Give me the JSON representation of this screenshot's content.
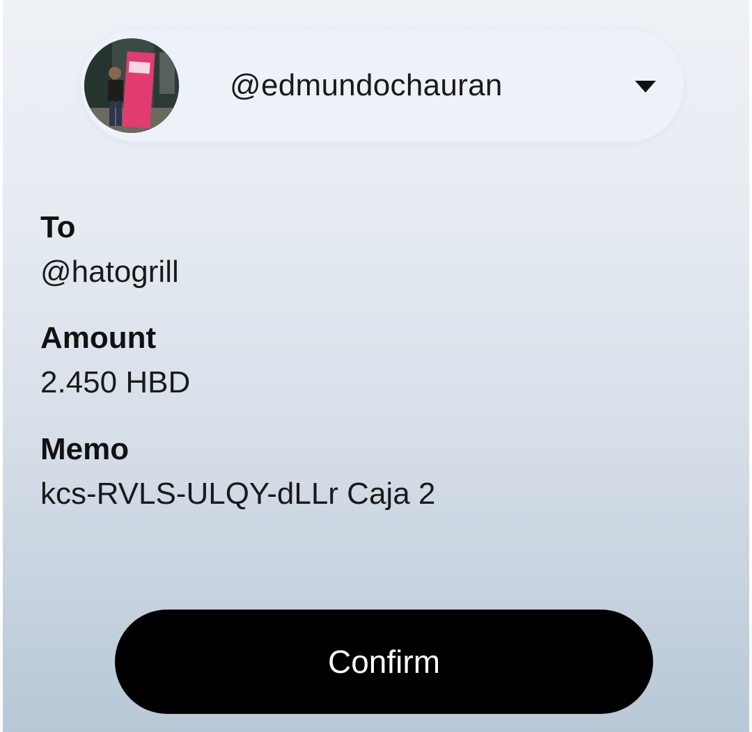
{
  "account": {
    "username": "@edmundochauran",
    "avatar": "user-avatar-photo",
    "dropdown_icon": "caret-down-icon"
  },
  "transfer": {
    "to_label": "To",
    "to_value": "@hatogrill",
    "amount_label": "Amount",
    "amount_value": "2.450 HBD",
    "memo_label": "Memo",
    "memo_value": "kcs-RVLS-ULQY-dLLr Caja 2"
  },
  "actions": {
    "confirm_label": "Confirm"
  },
  "colors": {
    "button_bg": "#000000",
    "button_text": "#ffffff",
    "text": "#1a1a1a",
    "background_top": "#eef2f7",
    "background_bottom": "#b8c8d6"
  }
}
